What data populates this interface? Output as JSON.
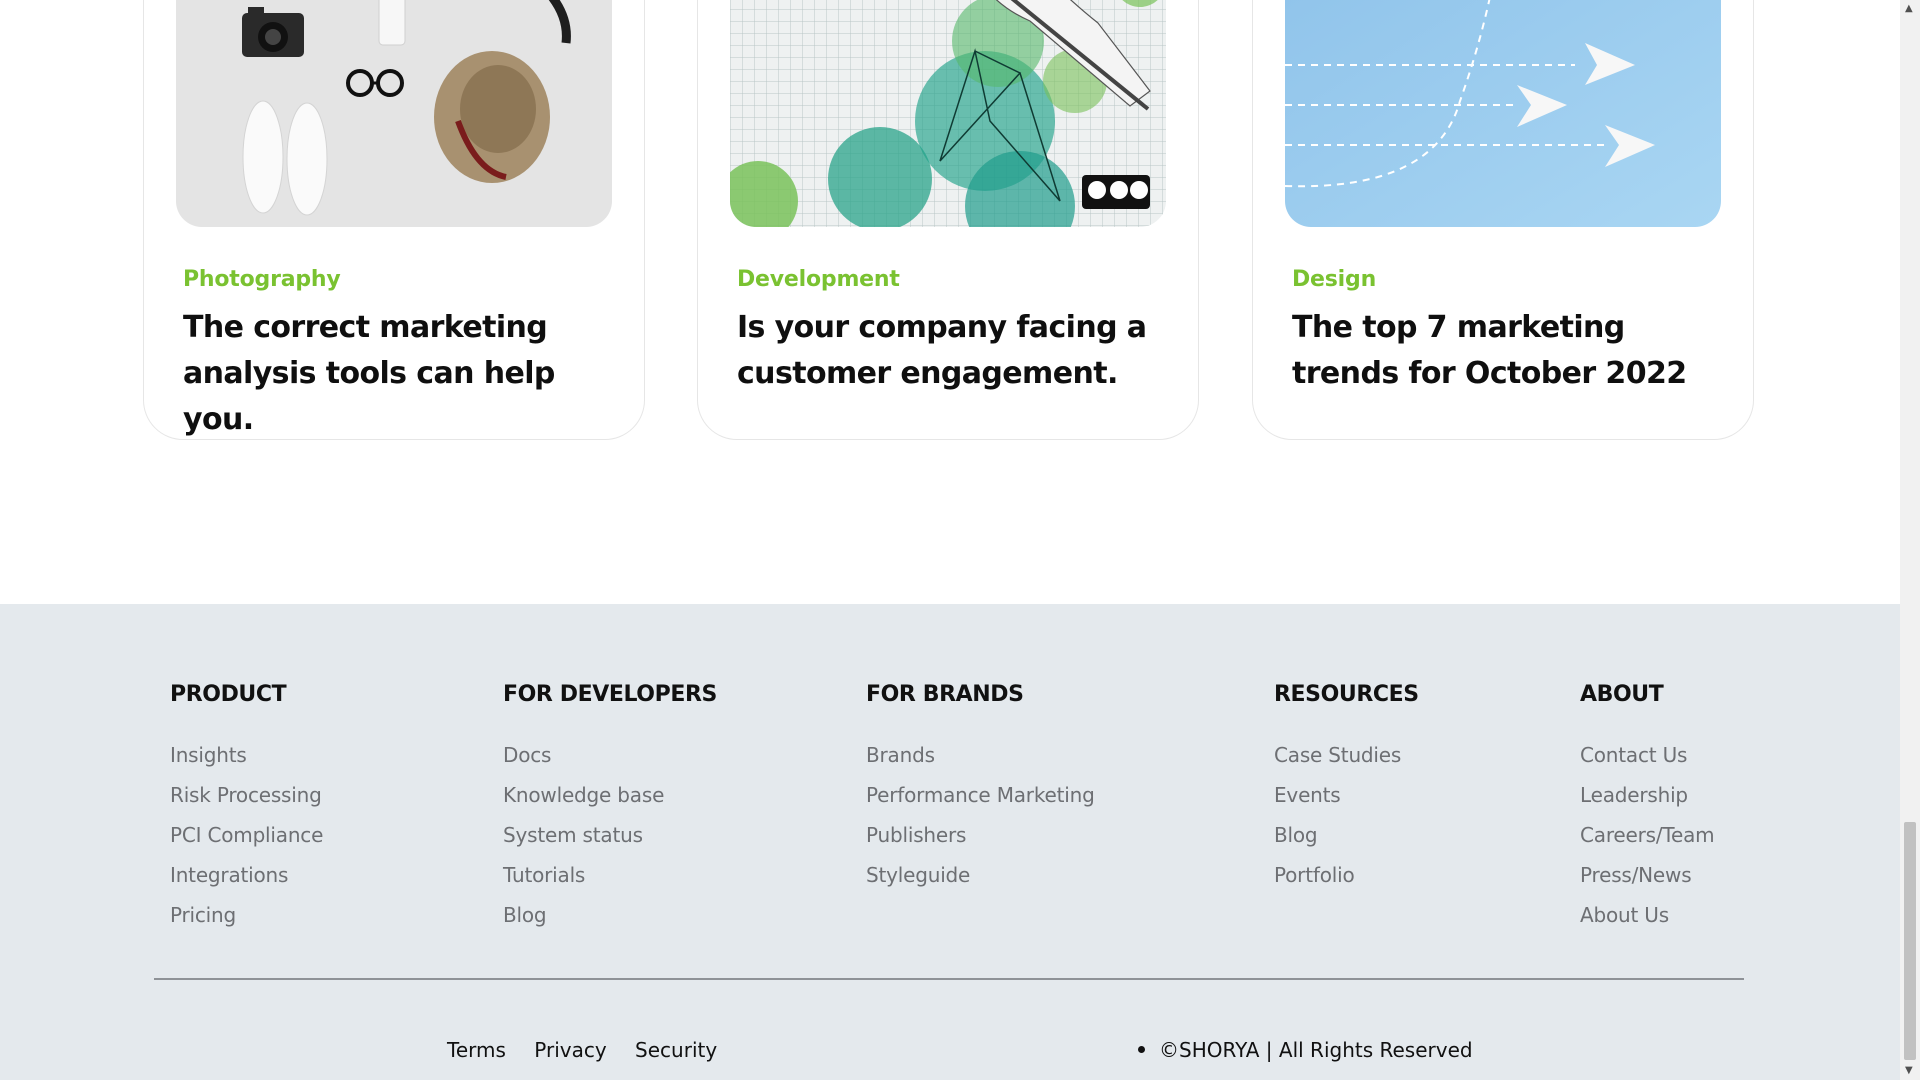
{
  "cards": [
    {
      "category": "Photography",
      "title": "The correct marketing analysis tools can help you.",
      "image": "flatlay-photography-image"
    },
    {
      "category": "Development",
      "title": "Is your company facing a customer engagement.",
      "image": "sketch-grid-development-image"
    },
    {
      "category": "Design",
      "title": "The top 7 marketing trends for October 2022",
      "image": "paper-planes-design-image"
    }
  ],
  "accent_color": "#7ac231",
  "footer_bg": "#e4e9ed",
  "footer": {
    "columns": [
      {
        "heading": "PRODUCT",
        "links": [
          "Insights",
          "Risk Processing",
          "PCI Compliance",
          "Integrations",
          "Pricing"
        ]
      },
      {
        "heading": "FOR DEVELOPERS",
        "links": [
          "Docs",
          "Knowledge base",
          "System status",
          "Tutorials",
          "Blog"
        ]
      },
      {
        "heading": "FOR BRANDS",
        "links": [
          "Brands",
          "Performance Marketing",
          "Publishers",
          "Styleguide"
        ]
      },
      {
        "heading": "RESOURCES",
        "links": [
          "Case Studies",
          "Events",
          "Blog",
          "Portfolio"
        ]
      },
      {
        "heading": "ABOUT",
        "links": [
          "Contact Us",
          "Leadership",
          "Careers/Team",
          "Press/News",
          "About Us"
        ]
      }
    ],
    "legal_links": [
      "Terms",
      "Privacy",
      "Security"
    ],
    "copyright": "©SHORYA | All Rights Reserved"
  },
  "scrollbar": {
    "up_icon": "scroll-up-arrow-icon",
    "down_icon": "scroll-down-arrow-icon"
  }
}
